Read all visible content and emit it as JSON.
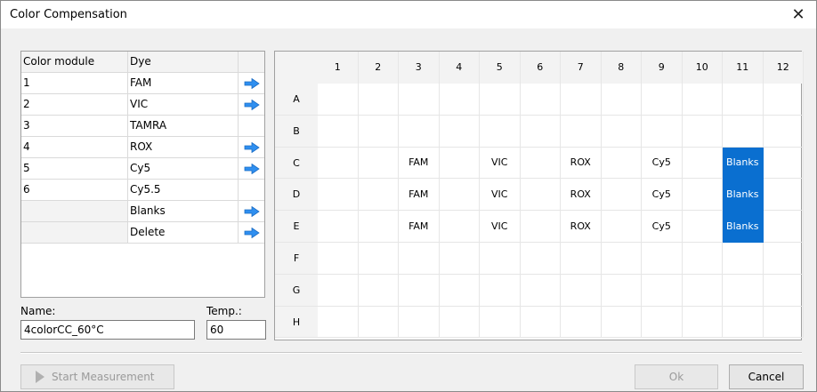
{
  "window": {
    "title": "Color Compensation",
    "close_glyph": "✕"
  },
  "dye_table": {
    "headers": {
      "module": "Color module",
      "dye": "Dye"
    },
    "rows": [
      {
        "module": "1",
        "dye": "FAM",
        "has_arrow": true
      },
      {
        "module": "2",
        "dye": "VIC",
        "has_arrow": true
      },
      {
        "module": "3",
        "dye": "TAMRA",
        "has_arrow": false
      },
      {
        "module": "4",
        "dye": "ROX",
        "has_arrow": true
      },
      {
        "module": "5",
        "dye": "Cy5",
        "has_arrow": true
      },
      {
        "module": "6",
        "dye": "Cy5.5",
        "has_arrow": false
      },
      {
        "module": "",
        "dye": "Blanks",
        "has_arrow": true
      },
      {
        "module": "",
        "dye": "Delete",
        "has_arrow": true
      }
    ],
    "arrow_icon": "right-arrow-icon",
    "arrow_color": "#2f8ff0"
  },
  "form": {
    "name_label": "Name:",
    "name_value": "4colorCC_60°C",
    "temp_label": "Temp.:",
    "temp_value": "60"
  },
  "plate": {
    "columns": [
      "1",
      "2",
      "3",
      "4",
      "5",
      "6",
      "7",
      "8",
      "9",
      "10",
      "11",
      "12"
    ],
    "rows": [
      "A",
      "B",
      "C",
      "D",
      "E",
      "F",
      "G",
      "H"
    ],
    "wells": [
      [
        "",
        "",
        "",
        "",
        "",
        "",
        "",
        "",
        "",
        "",
        "",
        ""
      ],
      [
        "",
        "",
        "",
        "",
        "",
        "",
        "",
        "",
        "",
        "",
        "",
        ""
      ],
      [
        "",
        "",
        "FAM",
        "",
        "VIC",
        "",
        "ROX",
        "",
        "Cy5",
        "",
        "Blanks",
        ""
      ],
      [
        "",
        "",
        "FAM",
        "",
        "VIC",
        "",
        "ROX",
        "",
        "Cy5",
        "",
        "Blanks",
        ""
      ],
      [
        "",
        "",
        "FAM",
        "",
        "VIC",
        "",
        "ROX",
        "",
        "Cy5",
        "",
        "Blanks",
        ""
      ],
      [
        "",
        "",
        "",
        "",
        "",
        "",
        "",
        "",
        "",
        "",
        "",
        ""
      ],
      [
        "",
        "",
        "",
        "",
        "",
        "",
        "",
        "",
        "",
        "",
        "",
        ""
      ],
      [
        "",
        "",
        "",
        "",
        "",
        "",
        "",
        "",
        "",
        "",
        "",
        ""
      ]
    ],
    "highlight_color": "#0a6fd0"
  },
  "buttons": {
    "start_measurement": "Start Measurement",
    "ok": "Ok",
    "cancel": "Cancel"
  }
}
